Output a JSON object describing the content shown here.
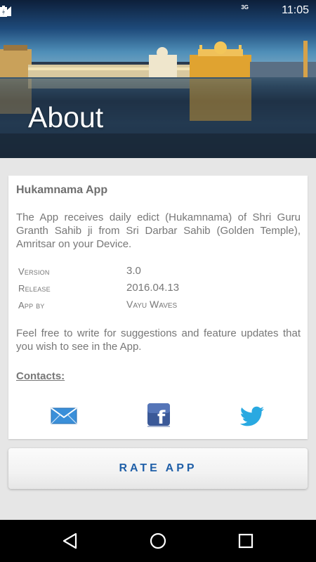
{
  "status_bar": {
    "time": "11:05",
    "network": "3G"
  },
  "header": {
    "title": "About"
  },
  "card": {
    "app_name": "Hukamnama App",
    "description": "The App receives daily edict (Hukamnama) of Shri Guru Granth Sahib ji from Sri Darbar Sahib (Golden Temple), Amritsar on your Device.",
    "info": [
      {
        "label": "Version",
        "value": "3.0"
      },
      {
        "label": "Release",
        "value": "2016.04.13"
      },
      {
        "label": "App by",
        "value": "Vayu Waves"
      }
    ],
    "feedback": "Feel free to write for suggestions and feature updates that you wish to see in the App.",
    "contacts_heading": "Contacts:",
    "contact_icons": [
      "mail-icon",
      "facebook-icon",
      "twitter-icon"
    ]
  },
  "rate_button": {
    "label": "RATE APP"
  },
  "colors": {
    "accent": "#1f5fa8",
    "background": "#e6e6e6",
    "text": "#777777",
    "mail": "#3a8fd9",
    "facebook": "#3b5998",
    "twitter": "#29a9e1"
  },
  "navbar": {
    "icons": [
      "back-icon",
      "home-icon",
      "recents-icon"
    ]
  }
}
